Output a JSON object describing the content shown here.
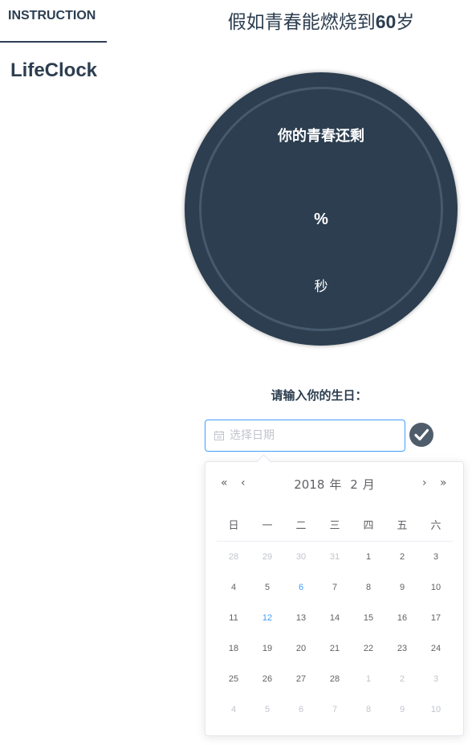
{
  "sidebar": {
    "tab_label": "INSTRUCTION",
    "brand": "LifeClock"
  },
  "header": {
    "title_prefix": "假如青春能燃烧到",
    "title_number": "60",
    "title_suffix": "岁"
  },
  "clock": {
    "heading": "你的青春还剩",
    "percent": "%",
    "seconds_unit": "秒"
  },
  "birthday_form": {
    "label": "请输入你的生日：",
    "placeholder": "选择日期",
    "confirm_icon": "check-circle-icon"
  },
  "datepicker": {
    "year": "2018",
    "year_unit": "年",
    "month": "2",
    "month_unit": "月",
    "prev_year": "«",
    "prev_month": "‹",
    "next_month": "›",
    "next_year": "»",
    "weekdays": [
      "日",
      "一",
      "二",
      "三",
      "四",
      "五",
      "六"
    ],
    "weeks": [
      [
        {
          "d": "28",
          "t": "other"
        },
        {
          "d": "29",
          "t": "other"
        },
        {
          "d": "30",
          "t": "other"
        },
        {
          "d": "31",
          "t": "other"
        },
        {
          "d": "1",
          "t": "cur"
        },
        {
          "d": "2",
          "t": "cur"
        },
        {
          "d": "3",
          "t": "cur"
        }
      ],
      [
        {
          "d": "4",
          "t": "cur"
        },
        {
          "d": "5",
          "t": "cur"
        },
        {
          "d": "6",
          "t": "avail"
        },
        {
          "d": "7",
          "t": "cur"
        },
        {
          "d": "8",
          "t": "cur"
        },
        {
          "d": "9",
          "t": "cur"
        },
        {
          "d": "10",
          "t": "cur"
        }
      ],
      [
        {
          "d": "11",
          "t": "cur"
        },
        {
          "d": "12",
          "t": "today"
        },
        {
          "d": "13",
          "t": "cur"
        },
        {
          "d": "14",
          "t": "cur"
        },
        {
          "d": "15",
          "t": "cur"
        },
        {
          "d": "16",
          "t": "cur"
        },
        {
          "d": "17",
          "t": "cur"
        }
      ],
      [
        {
          "d": "18",
          "t": "cur"
        },
        {
          "d": "19",
          "t": "cur"
        },
        {
          "d": "20",
          "t": "cur"
        },
        {
          "d": "21",
          "t": "cur"
        },
        {
          "d": "22",
          "t": "cur"
        },
        {
          "d": "23",
          "t": "cur"
        },
        {
          "d": "24",
          "t": "cur"
        }
      ],
      [
        {
          "d": "25",
          "t": "cur"
        },
        {
          "d": "26",
          "t": "cur"
        },
        {
          "d": "27",
          "t": "cur"
        },
        {
          "d": "28",
          "t": "cur"
        },
        {
          "d": "1",
          "t": "other"
        },
        {
          "d": "2",
          "t": "other"
        },
        {
          "d": "3",
          "t": "other"
        }
      ],
      [
        {
          "d": "4",
          "t": "other"
        },
        {
          "d": "5",
          "t": "other"
        },
        {
          "d": "6",
          "t": "other"
        },
        {
          "d": "7",
          "t": "other"
        },
        {
          "d": "8",
          "t": "other"
        },
        {
          "d": "9",
          "t": "other"
        },
        {
          "d": "10",
          "t": "other"
        }
      ]
    ]
  },
  "colors": {
    "primary_dark": "#2c3e50",
    "accent_blue": "#409eff",
    "muted_text": "#c0c4cc",
    "confirm_button": "#4f5d6b"
  }
}
